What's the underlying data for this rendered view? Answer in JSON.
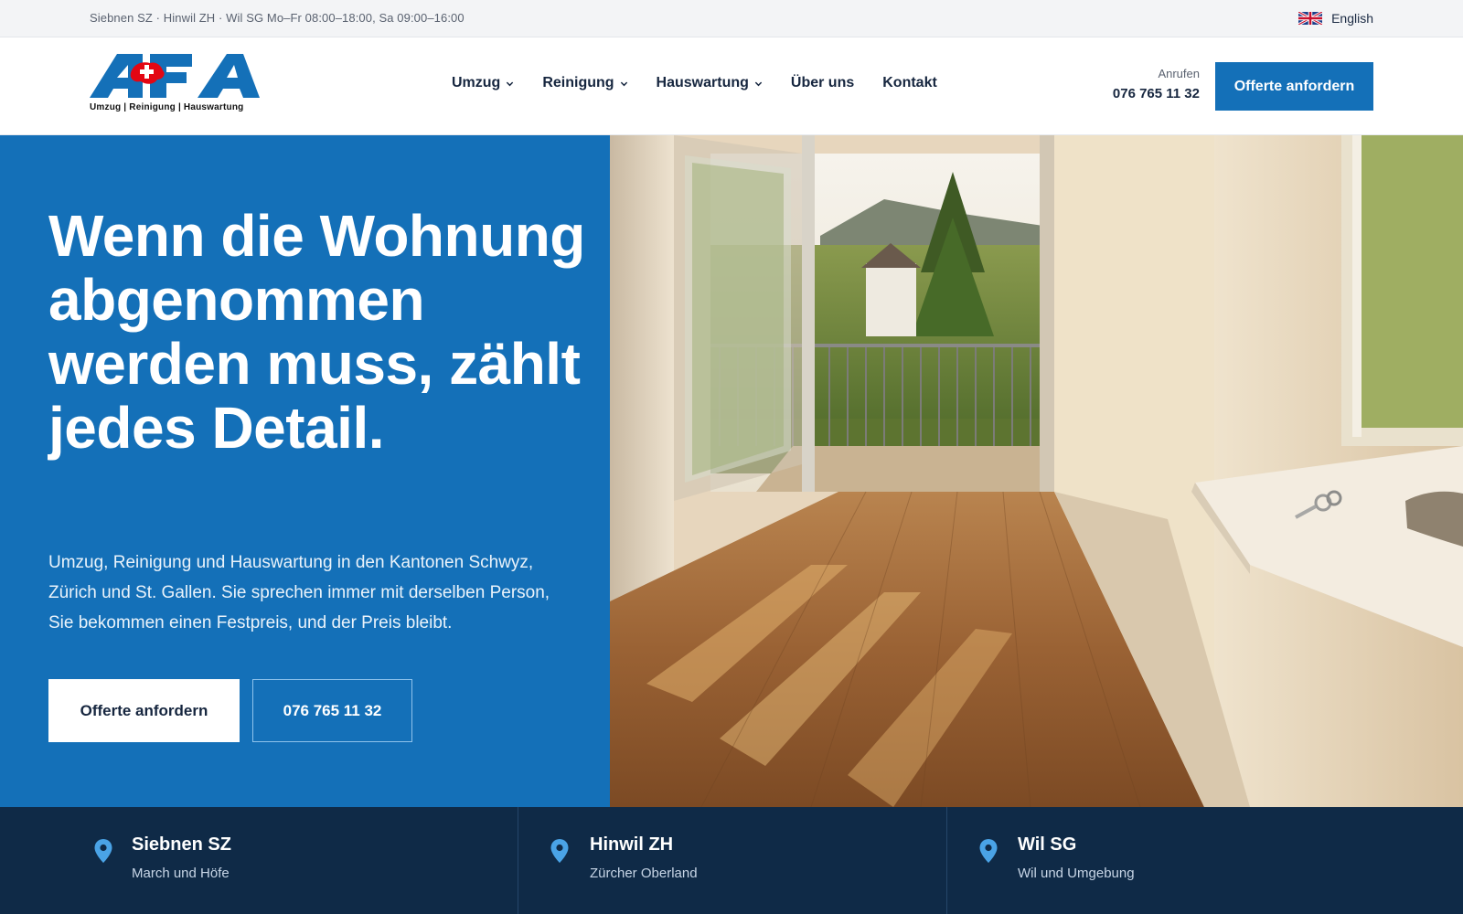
{
  "topbar": {
    "info": "Siebnen SZ · Hinwil ZH · Wil SG Mo–Fr 08:00–18:00, Sa 09:00–16:00",
    "language": "English",
    "flag_icon": "uk-flag-icon"
  },
  "header": {
    "logo_text": "AFA",
    "logo_tagline": "Umzug | Reinigung | Hauswartung",
    "nav": [
      {
        "label": "Umzug",
        "dropdown": true
      },
      {
        "label": "Reinigung",
        "dropdown": true
      },
      {
        "label": "Hauswartung",
        "dropdown": true
      },
      {
        "label": "Über uns",
        "dropdown": false
      },
      {
        "label": "Kontakt",
        "dropdown": false
      }
    ],
    "call_label": "Anrufen",
    "call_number": "076 765 11 32",
    "offer_button": "Offerte anfordern"
  },
  "hero": {
    "title": "Wenn die Wohnung abgenommen werden muss, zählt jedes Detail.",
    "subtitle": "Umzug, Reinigung und Hauswartung in den Kantonen Schwyz, Zürich und St. Gallen. Sie sprechen immer mit derselben Person, Sie bekommen einen Festpreis, und der Preis bleibt.",
    "primary_button": "Offerte anfordern",
    "secondary_button": "076 765 11 32"
  },
  "locations": [
    {
      "name": "Siebnen SZ",
      "region": "March und Höfe"
    },
    {
      "name": "Hinwil ZH",
      "region": "Zürcher Oberland"
    },
    {
      "name": "Wil SG",
      "region": "Wil und Umgebung"
    }
  ],
  "colors": {
    "brand_blue": "#1470b8",
    "navy": "#0f2a47",
    "swiss_red": "#e30613",
    "pin_blue": "#4aa3e6"
  }
}
